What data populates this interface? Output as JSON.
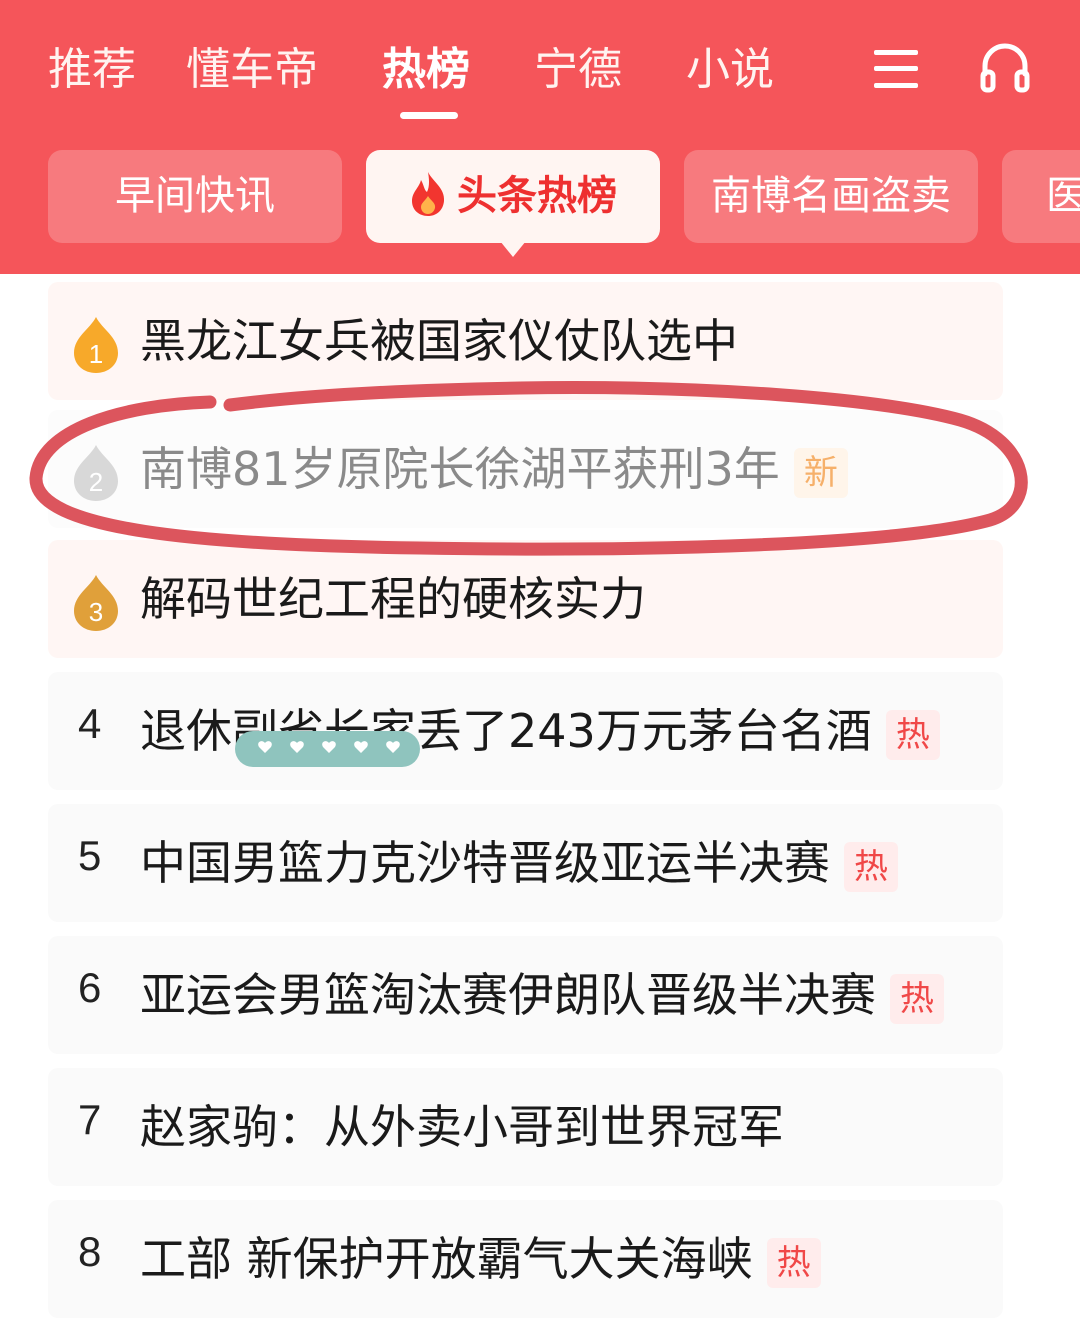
{
  "nav": {
    "tabs": [
      {
        "label": "推荐",
        "active": false
      },
      {
        "label": "懂车帝",
        "active": false
      },
      {
        "label": "热榜",
        "active": true
      },
      {
        "label": "宁德",
        "active": false
      },
      {
        "label": "小说",
        "active": false
      }
    ],
    "menu_icon": "menu-icon",
    "headphones_icon": "headphones-icon"
  },
  "chips": [
    {
      "label": "早间快讯",
      "active": false
    },
    {
      "label": "头条热榜",
      "active": true,
      "icon": "flame-icon"
    },
    {
      "label": "南博名画盗卖",
      "active": false
    },
    {
      "label": "医",
      "active": false
    }
  ],
  "list": [
    {
      "rank": "1",
      "title": "黑龙江女兵被国家仪仗队选中",
      "badge": "",
      "medal": "gold"
    },
    {
      "rank": "2",
      "title": "南博81岁原院长徐湖平获刑3年",
      "badge": "新",
      "badge_type": "new",
      "medal": "silver"
    },
    {
      "rank": "3",
      "title": "解码世纪工程的硬核实力",
      "badge": "",
      "medal": "bronze"
    },
    {
      "rank": "4",
      "title": "退休副省长家丢了243万元茅台名酒",
      "badge": "热",
      "badge_type": "hot"
    },
    {
      "rank": "5",
      "title": "中国男篮力克沙特晋级亚运半决赛",
      "badge": "热",
      "badge_type": "hot"
    },
    {
      "rank": "6",
      "title": "亚运会男篮淘汰赛伊朗队晋级半决赛",
      "badge": "热",
      "badge_type": "hot"
    },
    {
      "rank": "7",
      "title": "赵家驹：从外卖小哥到世界冠军",
      "badge": ""
    },
    {
      "rank": "8",
      "title": "工部 新保护开放霸气大关海峡",
      "badge": "热",
      "badge_type": "hot"
    }
  ],
  "colors": {
    "header_bg": "#f5555a",
    "active_chip_text": "#ee3030",
    "hot_badge": "#f04848",
    "new_badge": "#f6b06a",
    "annotation_circle": "#d9474f"
  }
}
